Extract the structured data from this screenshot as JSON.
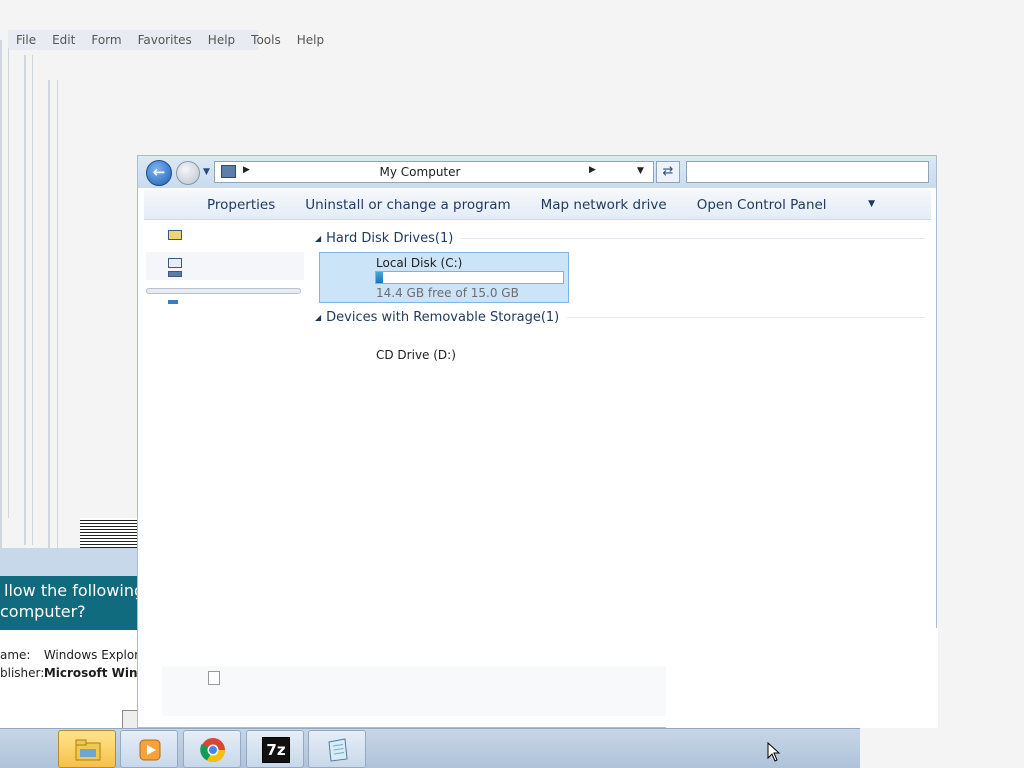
{
  "ghost_menubar": {
    "items": [
      "File",
      "Edit",
      "Form",
      "Favorites",
      "Help",
      "Tools",
      "Help"
    ]
  },
  "uac": {
    "close_label": "✕",
    "question_line1": "llow the following program to make",
    "question_line2": "computer?",
    "name_label": "ame:",
    "name_value": "Windows Explorer",
    "publisher_label": "blisher:",
    "publisher_value": "Microsoft Windows"
  },
  "explorer": {
    "address_text": "My Computer",
    "commands": [
      "Properties",
      "Uninstall or change a program",
      "Map network drive",
      "Open Control Panel"
    ],
    "groups": [
      {
        "title": "Hard Disk Drives",
        "count": "(1)"
      },
      {
        "title": "Devices with Removable Storage",
        "count": "(1)"
      }
    ],
    "local_disk": {
      "name": "Local Disk (C:)",
      "free_text": "14.4 GB free of 15.0 GB",
      "used_fraction": 0.04
    },
    "cd_drive": {
      "name": "CD Drive (D:)"
    }
  },
  "taskbar": {
    "items": [
      {
        "name": "windows-explorer",
        "icon": "folder-icon",
        "active": true
      },
      {
        "name": "media-player",
        "icon": "media-player-icon",
        "active": false
      },
      {
        "name": "chrome",
        "icon": "chrome-icon",
        "active": false
      },
      {
        "name": "7zip",
        "icon": "7zip-icon",
        "label": "7z",
        "active": false
      },
      {
        "name": "notepad",
        "icon": "notepad-icon",
        "active": false
      }
    ]
  },
  "colors": {
    "accent": "#1e395b",
    "uac_header": "#116b7e",
    "selection": "#cce4f7"
  }
}
